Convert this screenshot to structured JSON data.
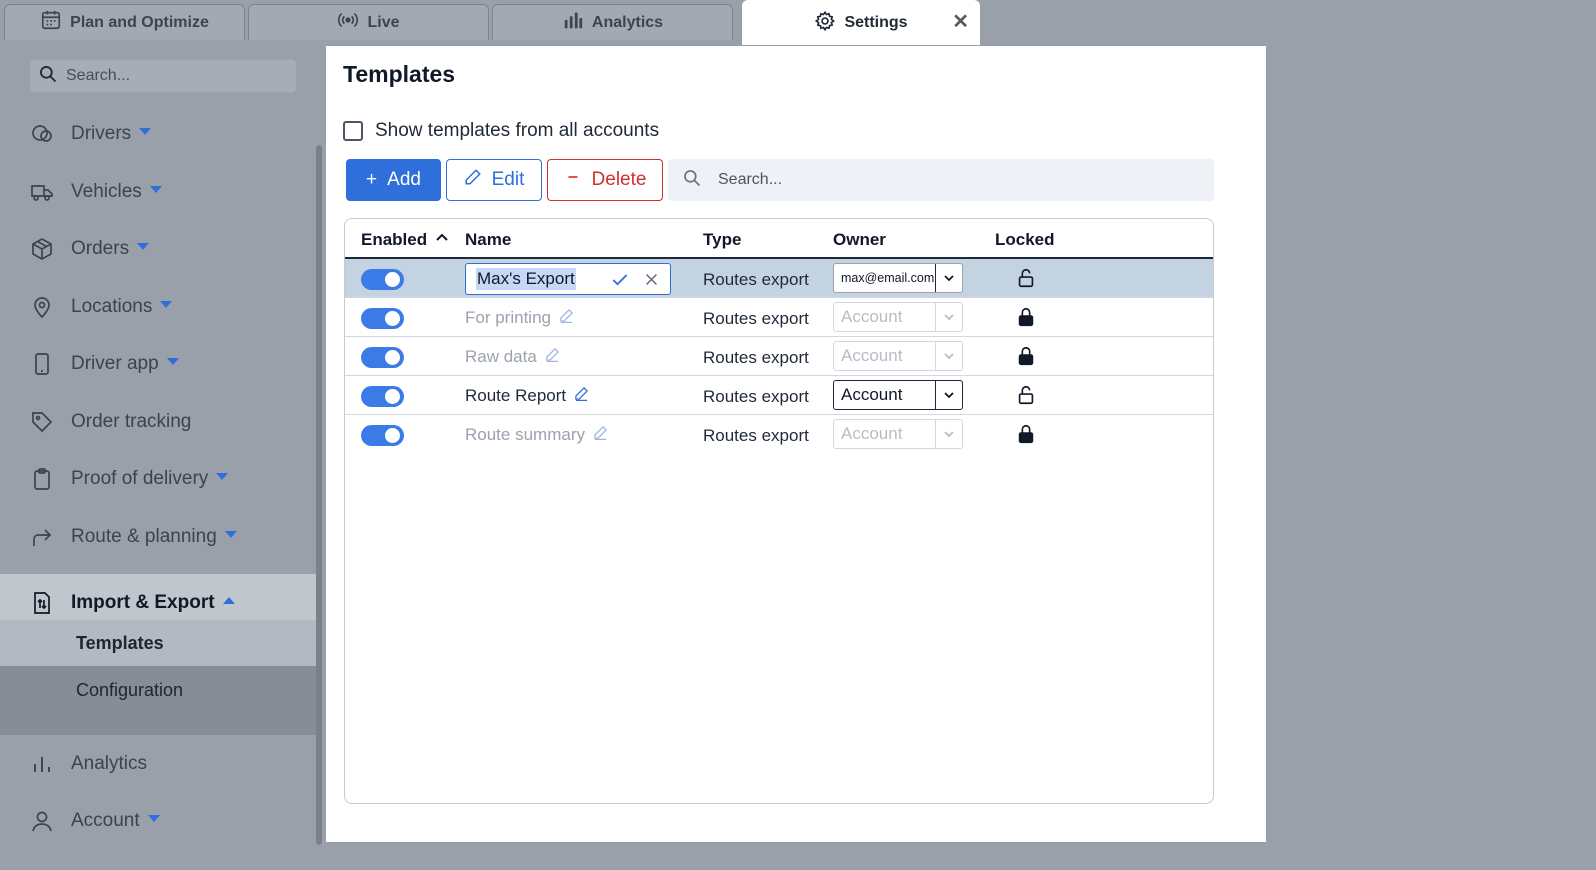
{
  "tabs": [
    {
      "label": "Plan and Optimize",
      "icon": "calendar-icon"
    },
    {
      "label": "Live",
      "icon": "broadcast-icon"
    },
    {
      "label": "Analytics",
      "icon": "bar-chart-icon"
    },
    {
      "label": "Settings",
      "icon": "gear-icon",
      "active": true,
      "close": "✕"
    }
  ],
  "sidebar": {
    "search_placeholder": "Search...",
    "items": [
      {
        "label": "Drivers",
        "icon": "steering-icon"
      },
      {
        "label": "Vehicles",
        "icon": "truck-icon"
      },
      {
        "label": "Orders",
        "icon": "package-icon"
      },
      {
        "label": "Locations",
        "icon": "map-pin-icon"
      },
      {
        "label": "Driver app",
        "icon": "phone-icon"
      },
      {
        "label": "Order tracking",
        "icon": "tag-icon"
      },
      {
        "label": "Proof of delivery",
        "icon": "clipboard-icon"
      },
      {
        "label": "Route & planning",
        "icon": "route-arrow-icon"
      },
      {
        "label": "Import & Export",
        "icon": "import-export-icon"
      },
      {
        "label": "Analytics",
        "icon": "bar-chart-icon"
      },
      {
        "label": "Account",
        "icon": "user-icon"
      }
    ],
    "subitems": [
      {
        "label": "Templates",
        "active": true
      },
      {
        "label": "Configuration"
      }
    ]
  },
  "modal": {
    "title": "Templates",
    "show_all_label": "Show templates from all accounts",
    "buttons": {
      "add": "Add",
      "edit": "Edit",
      "delete": "Delete",
      "add_symbol": "+"
    },
    "search_placeholder": "Search...",
    "columns": {
      "enabled": "Enabled",
      "name": "Name",
      "type": "Type",
      "owner": "Owner",
      "locked": "Locked"
    },
    "rows": [
      {
        "name": "Max's Export",
        "type": "Routes export",
        "owner": "max@email.com",
        "locked": false,
        "enabled": true,
        "editing": true
      },
      {
        "name": "For printing",
        "type": "Routes export",
        "owner": "Account",
        "locked": true,
        "enabled": true
      },
      {
        "name": "Raw data",
        "type": "Routes export",
        "owner": "Account",
        "locked": true,
        "enabled": true
      },
      {
        "name": "Route Report",
        "type": "Routes export",
        "owner": "Account",
        "locked": false,
        "enabled": true
      },
      {
        "name": "Route summary",
        "type": "Routes export",
        "owner": "Account",
        "locked": true,
        "enabled": true
      }
    ]
  },
  "colors": {
    "accent": "#2f6fdc",
    "danger": "#d0312d",
    "selected_row": "#c3d3e2"
  }
}
